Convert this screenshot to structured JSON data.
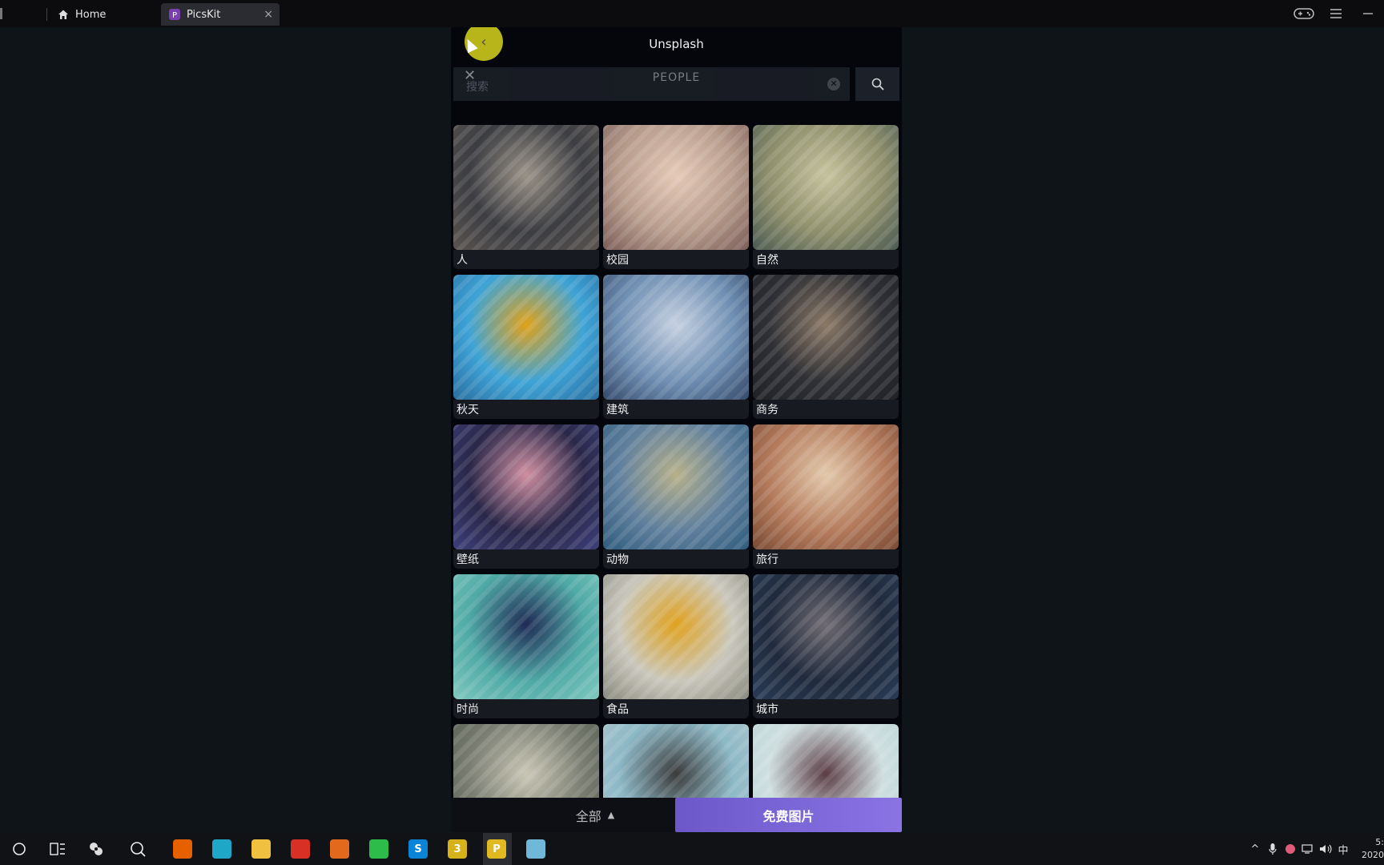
{
  "tabs": {
    "home_label": "Home",
    "picskit_label": "PicsKit",
    "close_glyph": "×"
  },
  "panel": {
    "title": "Unsplash",
    "category_title": "PEOPLE",
    "search_placeholder": "搜索",
    "close_glyph": "✕"
  },
  "grid": [
    {
      "label": "人",
      "colors": [
        "#3c3d42",
        "#9a9287",
        "#5a544f"
      ]
    },
    {
      "label": "校园",
      "colors": [
        "#b79c8c",
        "#e5c9b7",
        "#7b5d59"
      ]
    },
    {
      "label": "自然",
      "colors": [
        "#8e8f6c",
        "#c6c29d",
        "#4b5a52"
      ]
    },
    {
      "label": "秋天",
      "colors": [
        "#3ea3d6",
        "#e0a21a",
        "#2a6fa0"
      ]
    },
    {
      "label": "建筑",
      "colors": [
        "#6f8fb3",
        "#c5d0e0",
        "#34496a"
      ]
    },
    {
      "label": "商务",
      "colors": [
        "#2f3035",
        "#8b7967",
        "#202126"
      ]
    },
    {
      "label": "壁纸",
      "colors": [
        "#2a2749",
        "#cf8fa0",
        "#3c3f7a"
      ]
    },
    {
      "label": "动物",
      "colors": [
        "#5f7f9d",
        "#b6b08a",
        "#2f5c7d"
      ]
    },
    {
      "label": "旅行",
      "colors": [
        "#b47b5d",
        "#e2c8aa",
        "#7a4a33"
      ]
    },
    {
      "label": "时尚",
      "colors": [
        "#4fa9a6",
        "#1f2b55",
        "#7fc8be"
      ]
    },
    {
      "label": "食品",
      "colors": [
        "#c9c7bc",
        "#e0a21f",
        "#8b8a7e"
      ]
    },
    {
      "label": "城市",
      "colors": [
        "#1f2a3c",
        "#6f6a72",
        "#2a3b57"
      ]
    },
    {
      "label": "",
      "colors": [
        "#7a7e72",
        "#c9c6b5",
        "#545a4e"
      ]
    },
    {
      "label": "",
      "colors": [
        "#8cb8c6",
        "#3c3c3c",
        "#b0c7cc"
      ]
    },
    {
      "label": "",
      "colors": [
        "#cfdfe0",
        "#5a3c44",
        "#b8d2d3"
      ]
    }
  ],
  "bottom": {
    "all_label": "全部",
    "free_label": "免费图片"
  },
  "taskbar": {
    "apps": [
      {
        "name": "firefox",
        "glyph": "",
        "color": "#e66000"
      },
      {
        "name": "edge",
        "glyph": "",
        "color": "#1fa7c7"
      },
      {
        "name": "file-explorer",
        "glyph": "",
        "color": "#f0c040"
      },
      {
        "name": "chrome",
        "glyph": "",
        "color": "#d93025"
      },
      {
        "name": "app-fox",
        "glyph": "",
        "color": "#e36a1d"
      },
      {
        "name": "wechat",
        "glyph": "",
        "color": "#2dbb4a"
      },
      {
        "name": "skype",
        "glyph": "S",
        "color": "#0a84d6"
      },
      {
        "name": "app-3",
        "glyph": "3",
        "color": "#d6b21a"
      },
      {
        "name": "picskit",
        "glyph": "P",
        "color": "#e0b81f"
      },
      {
        "name": "app-doc",
        "glyph": "",
        "color": "#6fb8d8"
      }
    ],
    "ime_label": "中",
    "clock_time": "5:",
    "clock_date": "2020"
  }
}
